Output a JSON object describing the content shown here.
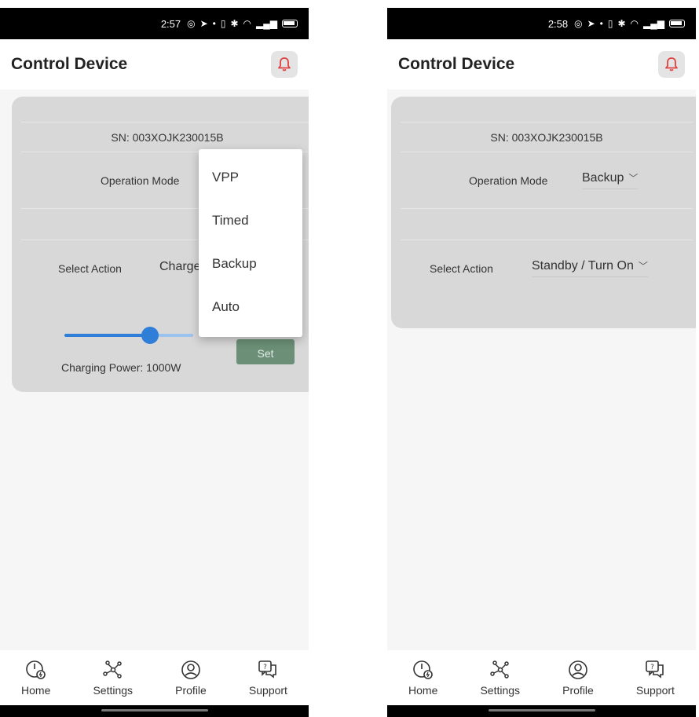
{
  "screens": [
    {
      "status": {
        "time": "2:57"
      },
      "title": "Control Device",
      "sn": "SN: 003XOJK230015B",
      "operation_mode_label": "Operation Mode",
      "select_action_label": "Select Action",
      "select_action_value": "Charge",
      "charging_power": "Charging Power: 1000W",
      "charging_power_level_pct": 67,
      "set_button": "Set",
      "dropdown_options": [
        "VPP",
        "Timed",
        "Backup",
        "Auto"
      ]
    },
    {
      "status": {
        "time": "2:58"
      },
      "title": "Control Device",
      "sn": "SN: 003XOJK230015B",
      "operation_mode_label": "Operation Mode",
      "operation_mode_value": "Backup",
      "select_action_label": "Select Action",
      "select_action_value": "Standby / Turn On"
    }
  ],
  "nav": {
    "home": "Home",
    "settings": "Settings",
    "profile": "Profile",
    "support": "Support"
  },
  "colors": {
    "accent": "#2f7fd9",
    "bell": "#e04040",
    "set_button": "#6b8f77",
    "card": "#d8d8d8"
  }
}
